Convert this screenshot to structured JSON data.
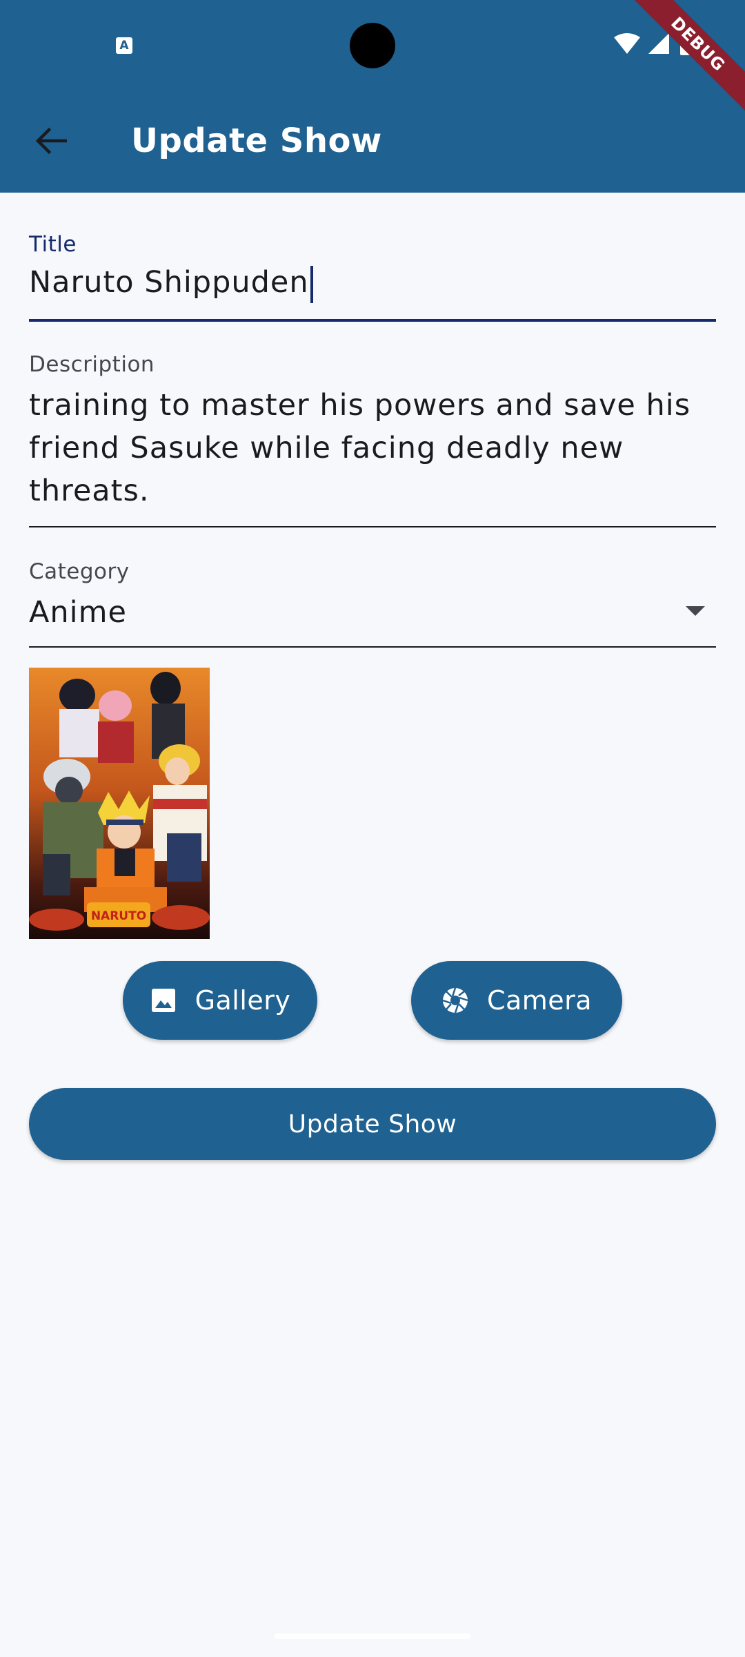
{
  "app_bar": {
    "title": "Update Show",
    "back_icon": "arrow-back-icon",
    "color": "#1f6190"
  },
  "status_bar": {
    "notification_icon_letter": "A",
    "icons": [
      "wifi-icon",
      "signal-icon",
      "battery-icon"
    ],
    "debug_banner": "DEBUG"
  },
  "form": {
    "title": {
      "label": "Title",
      "value": "Naruto Shippuden"
    },
    "description": {
      "label": "Description",
      "value": "training to master his powers and save his friend Sasuke while facing deadly new threats."
    },
    "category": {
      "label": "Category",
      "value": "Anime"
    }
  },
  "image": {
    "logo_text": "NARUTO"
  },
  "buttons": {
    "gallery": "Gallery",
    "camera": "Camera",
    "update": "Update Show"
  },
  "colors": {
    "primary": "#1f6190",
    "focus": "#152a6b",
    "background": "#f7f8fb"
  }
}
